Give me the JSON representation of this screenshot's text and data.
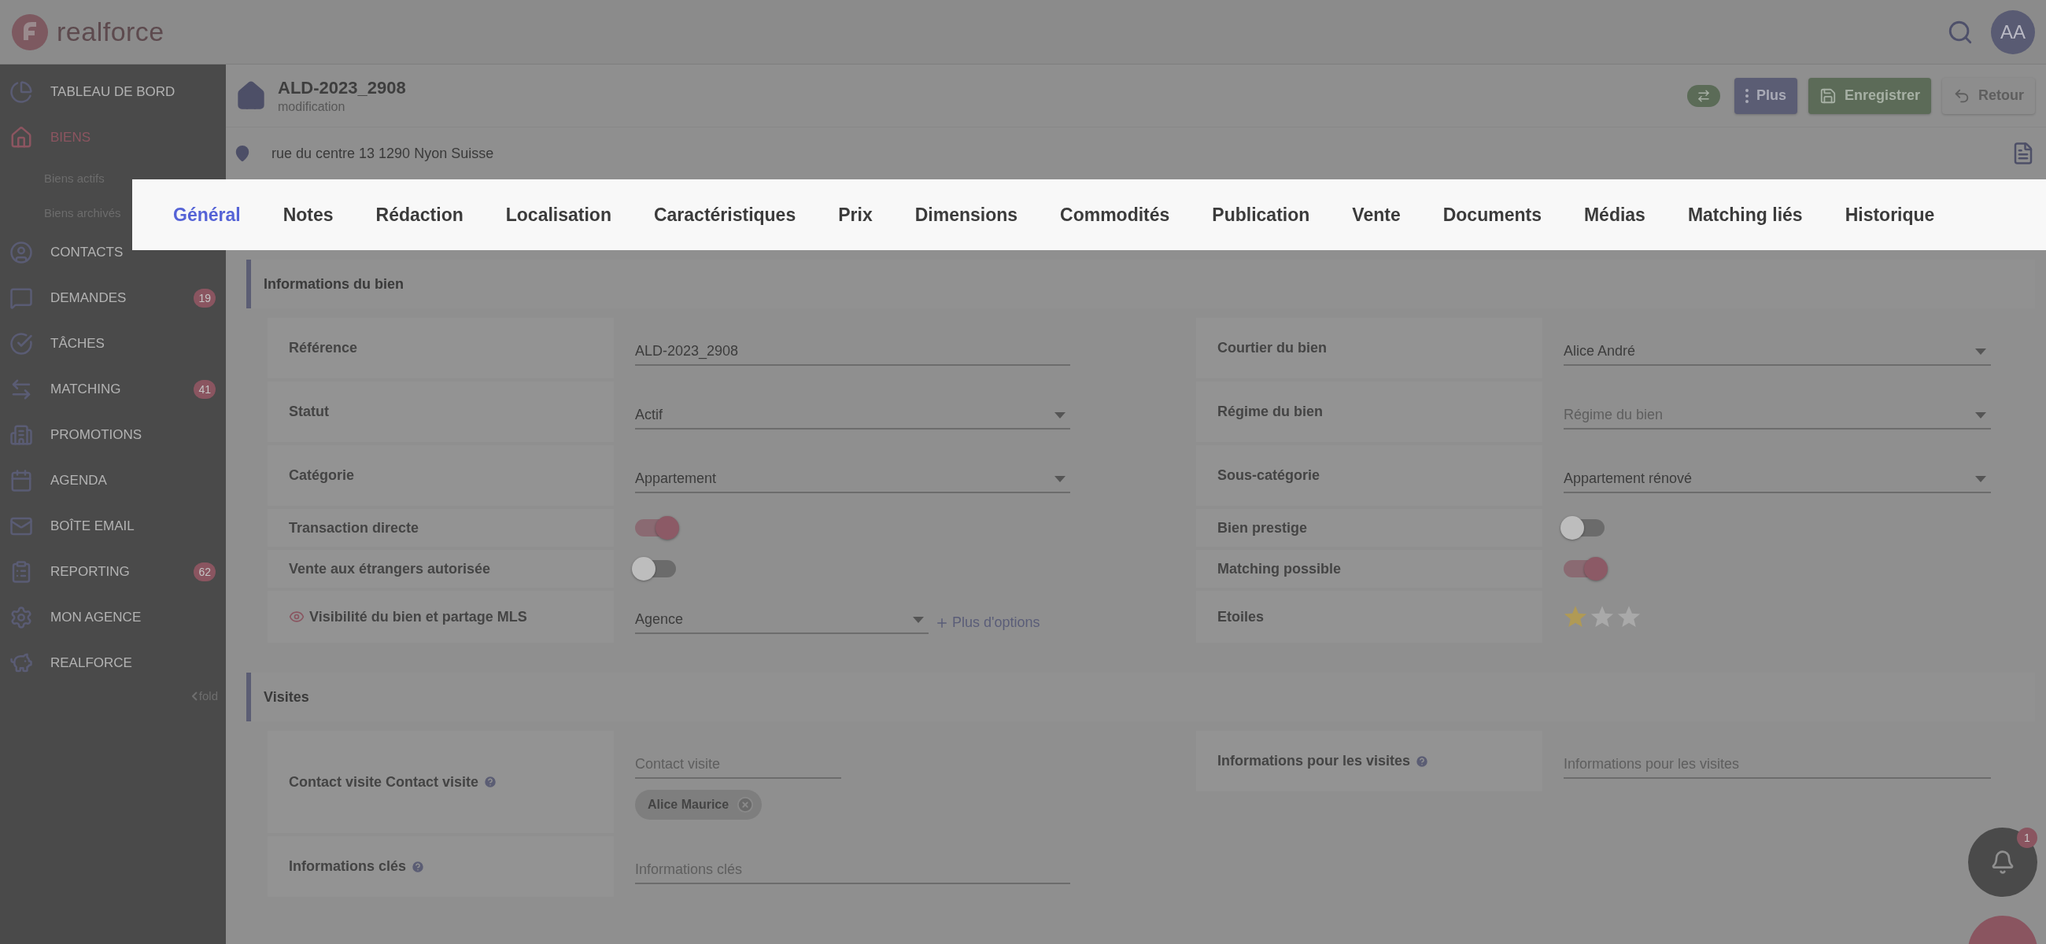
{
  "header": {
    "logo_text": "realforce",
    "avatar": "AA"
  },
  "sidebar": {
    "items": [
      {
        "label": "TABLEAU DE BORD",
        "selected": false
      },
      {
        "label": "BIENS",
        "selected": true,
        "children": [
          {
            "label": "Biens actifs"
          },
          {
            "label": "Biens archivés"
          }
        ]
      },
      {
        "label": "CONTACTS",
        "selected": false
      },
      {
        "label": "DEMANDES",
        "selected": false,
        "badge": "19"
      },
      {
        "label": "TÂCHES",
        "selected": false
      },
      {
        "label": "MATCHING",
        "selected": false,
        "badge": "41"
      },
      {
        "label": "PROMOTIONS",
        "selected": false
      },
      {
        "label": "AGENDA",
        "selected": false
      },
      {
        "label": "BOÎTE EMAIL",
        "selected": false
      },
      {
        "label": "REPORTING",
        "selected": false,
        "badge": "62"
      },
      {
        "label": "MON AGENCE",
        "selected": false
      },
      {
        "label": "REALFORCE",
        "selected": false
      }
    ],
    "fold": "fold"
  },
  "record": {
    "title": "ALD-2023_2908",
    "subtitle": "modification",
    "address": "rue du centre 13 1290 Nyon Suisse"
  },
  "actions": [
    {
      "label": "Plus",
      "kind": "menu"
    },
    {
      "label": "Enregistrer",
      "kind": "save"
    },
    {
      "label": "Retour",
      "kind": "back"
    }
  ],
  "tabs": [
    {
      "label": "Général",
      "selected": true
    },
    {
      "label": "Notes",
      "selected": false
    },
    {
      "label": "Rédaction",
      "selected": false
    },
    {
      "label": "Localisation",
      "selected": false
    },
    {
      "label": "Caractéristiques",
      "selected": false
    },
    {
      "label": "Prix",
      "selected": false
    },
    {
      "label": "Dimensions",
      "selected": false
    },
    {
      "label": "Commodités",
      "selected": false
    },
    {
      "label": "Publication",
      "selected": false
    },
    {
      "label": "Vente",
      "selected": false
    },
    {
      "label": "Documents",
      "selected": false
    },
    {
      "label": "Médias",
      "selected": false
    },
    {
      "label": "Matching liés",
      "selected": false
    },
    {
      "label": "Historique",
      "selected": false
    }
  ],
  "sections": [
    {
      "title": "Informations du bien",
      "left": [
        {
          "kind": "text",
          "label": "Référence",
          "value": "ALD-2023_2908"
        },
        {
          "kind": "select",
          "label": "Statut",
          "value": "Actif"
        },
        {
          "kind": "select",
          "label": "Catégorie",
          "value": "Appartement"
        },
        {
          "kind": "toggle",
          "label": "Transaction directe",
          "on": true
        },
        {
          "kind": "toggle",
          "label": "Vente aux étrangers autorisée",
          "on": false
        },
        {
          "kind": "select_link",
          "label": "Visibilité du bien et partage MLS",
          "eye": true,
          "value": "Agence",
          "link": "Plus d'options"
        }
      ],
      "right": [
        {
          "kind": "select",
          "label": "Courtier du bien",
          "value": "Alice André"
        },
        {
          "kind": "select",
          "label": "Régime du bien",
          "placeholder": "Régime du bien"
        },
        {
          "kind": "select",
          "label": "Sous-catégorie",
          "value": "Appartement rénové"
        },
        {
          "kind": "toggle",
          "label": "Bien prestige",
          "on": false
        },
        {
          "kind": "toggle",
          "label": "Matching possible",
          "on": true
        },
        {
          "kind": "stars",
          "label": "Etoiles",
          "stars": 1
        }
      ]
    },
    {
      "title": "Visites",
      "left": [
        {
          "kind": "contact",
          "label": "Contact visite Contact visite",
          "help": true,
          "placeholder": "Contact visite",
          "chips": [
            "Alice Maurice"
          ]
        },
        {
          "kind": "text",
          "label": "Informations clés",
          "help": true,
          "placeholder": "Informations clés"
        }
      ],
      "right": [
        {
          "kind": "text",
          "label": "Informations pour les visites",
          "help": true,
          "placeholder": "Informations pour les visites"
        }
      ]
    }
  ],
  "notifications": {
    "count": "1"
  }
}
